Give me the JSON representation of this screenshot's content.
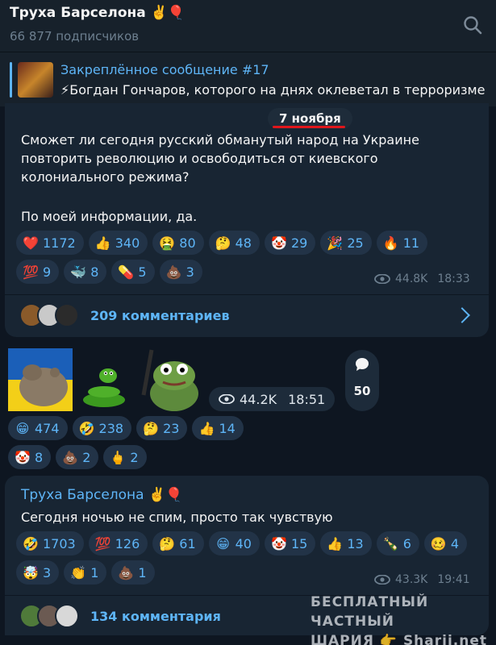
{
  "channel": {
    "title": "Труха Барселона ✌️🎈",
    "subscribers": "66 877 подписчиков"
  },
  "pinned": {
    "label": "Закреплённое сообщение #17",
    "text": "⚡Богдан Гончаров, которого на днях оклеветал в терроризме"
  },
  "date_separator": "7 ноября",
  "message1": {
    "lines": [
      "Сможет ли сегодня русский обманутый народ на Украине",
      "повторить революцию и освободиться от киевского",
      "колониального режима?",
      "По моей информации, да."
    ],
    "reactions": [
      {
        "emoji": "❤️",
        "count": "1172"
      },
      {
        "emoji": "👍",
        "count": "340"
      },
      {
        "emoji": "🤮",
        "count": "80"
      },
      {
        "emoji": "🤔",
        "count": "48"
      },
      {
        "emoji": "🤡",
        "count": "29"
      },
      {
        "emoji": "🎉",
        "count": "25"
      },
      {
        "emoji": "🔥",
        "count": "11"
      },
      {
        "emoji": "💯",
        "count": "9"
      },
      {
        "emoji": "🐳",
        "count": "8"
      },
      {
        "emoji": "💊",
        "count": "5"
      },
      {
        "emoji": "💩",
        "count": "3"
      }
    ],
    "views": "44.8K",
    "time": "18:33",
    "comments": "209 комментариев"
  },
  "message2": {
    "views": "44.2K",
    "time": "18:51",
    "comment_count": "50",
    "reactions": [
      {
        "emoji": "😁",
        "count": "474"
      },
      {
        "emoji": "🤣",
        "count": "238"
      },
      {
        "emoji": "🤔",
        "count": "23"
      },
      {
        "emoji": "👍",
        "count": "14"
      },
      {
        "emoji": "🤡",
        "count": "8"
      },
      {
        "emoji": "💩",
        "count": "2"
      },
      {
        "emoji": "🖕",
        "count": "2"
      }
    ]
  },
  "message3": {
    "author": "Труха Барселона ✌️🎈",
    "text": "Сегодня ночью не спим, просто так чувствую",
    "reactions": [
      {
        "emoji": "🤣",
        "count": "1703"
      },
      {
        "emoji": "💯",
        "count": "126"
      },
      {
        "emoji": "🤔",
        "count": "61"
      },
      {
        "emoji": "😁",
        "count": "40"
      },
      {
        "emoji": "🤡",
        "count": "15"
      },
      {
        "emoji": "👍",
        "count": "13"
      },
      {
        "emoji": "🍾",
        "count": "6"
      },
      {
        "emoji": "🥴",
        "count": "4"
      },
      {
        "emoji": "🤯",
        "count": "3"
      },
      {
        "emoji": "👏",
        "count": "1"
      },
      {
        "emoji": "💩",
        "count": "1"
      }
    ],
    "views": "43.3K",
    "time": "19:41",
    "comments": "134 комментария"
  },
  "watermark": {
    "line1": "БЕСПЛАТНЫЙ ЧАСТНЫЙ",
    "line2": "ШАРИЯ 👉 Sharij.net"
  },
  "colors": {
    "background": "#0e1621",
    "bubble": "#182533",
    "accent": "#5eb5f7",
    "meta": "#6d7f8f",
    "date_underline": "#e0161b"
  }
}
